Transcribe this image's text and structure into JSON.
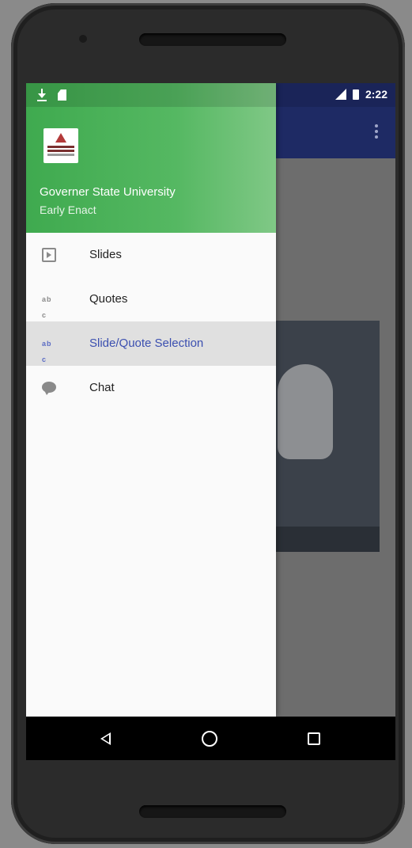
{
  "status": {
    "time": "2:22"
  },
  "drawer": {
    "header": {
      "title": "Governer State University",
      "subtitle": "Early Enact"
    },
    "items": [
      {
        "label": "Slides",
        "icon": "slideshow-icon"
      },
      {
        "label": "Quotes",
        "icon": "text-format-icon"
      },
      {
        "label": "Slide/Quote Selection",
        "icon": "text-format-icon",
        "active": true
      },
      {
        "label": "Chat",
        "icon": "chat-bubble-icon"
      }
    ]
  },
  "colors": {
    "header_green": "#4caf50",
    "toolbar_indigo": "#1e2a64",
    "active_text": "#3b4fb0"
  }
}
